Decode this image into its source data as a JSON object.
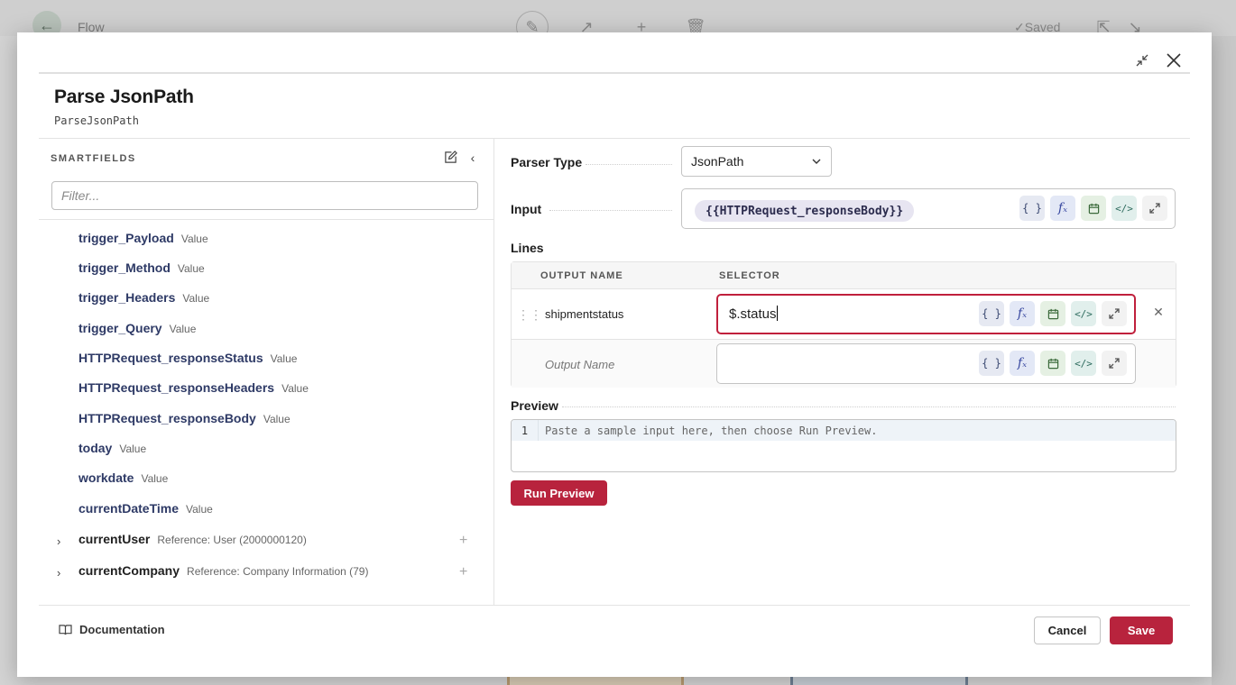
{
  "background": {
    "app_title": "Flow",
    "saved_label": "Saved"
  },
  "modal": {
    "title": "Parse JsonPath",
    "subtitle": "ParseJsonPath"
  },
  "smartfields": {
    "header": "SMARTFIELDS",
    "filter_placeholder": "Filter...",
    "fields": [
      {
        "name": "trigger_Payload",
        "type": "Value"
      },
      {
        "name": "trigger_Method",
        "type": "Value"
      },
      {
        "name": "trigger_Headers",
        "type": "Value"
      },
      {
        "name": "trigger_Query",
        "type": "Value"
      },
      {
        "name": "HTTPRequest_responseStatus",
        "type": "Value"
      },
      {
        "name": "HTTPRequest_responseHeaders",
        "type": "Value"
      },
      {
        "name": "HTTPRequest_responseBody",
        "type": "Value"
      },
      {
        "name": "today",
        "type": "Value"
      },
      {
        "name": "workdate",
        "type": "Value"
      },
      {
        "name": "currentDateTime",
        "type": "Value"
      }
    ],
    "references": [
      {
        "name": "currentUser",
        "type": "Reference: User (2000000120)"
      },
      {
        "name": "currentCompany",
        "type": "Reference: Company Information (79)"
      }
    ]
  },
  "form": {
    "parser_type_label": "Parser Type",
    "parser_type_value": "JsonPath",
    "input_label": "Input",
    "input_value": "{{HTTPRequest_responseBody}}",
    "lines_label": "Lines",
    "lines_headers": {
      "output_name": "OUTPUT NAME",
      "selector": "SELECTOR"
    },
    "lines": [
      {
        "output_name": "shipmentstatus",
        "selector": "$.status"
      }
    ],
    "new_line_placeholder": "Output Name",
    "preview_label": "Preview",
    "preview_line_number": "1",
    "preview_placeholder": "Paste a sample input here, then choose Run Preview.",
    "run_preview_label": "Run Preview"
  },
  "footer": {
    "documentation_label": "Documentation",
    "cancel_label": "Cancel",
    "save_label": "Save"
  },
  "tool_icons": [
    "braces-icon",
    "function-icon",
    "calendar-icon",
    "code-icon",
    "expand-icon"
  ],
  "colors": {
    "accent": "#b8233d",
    "field_name": "#2e3a66",
    "pill_bg": "#e7e5f1"
  }
}
